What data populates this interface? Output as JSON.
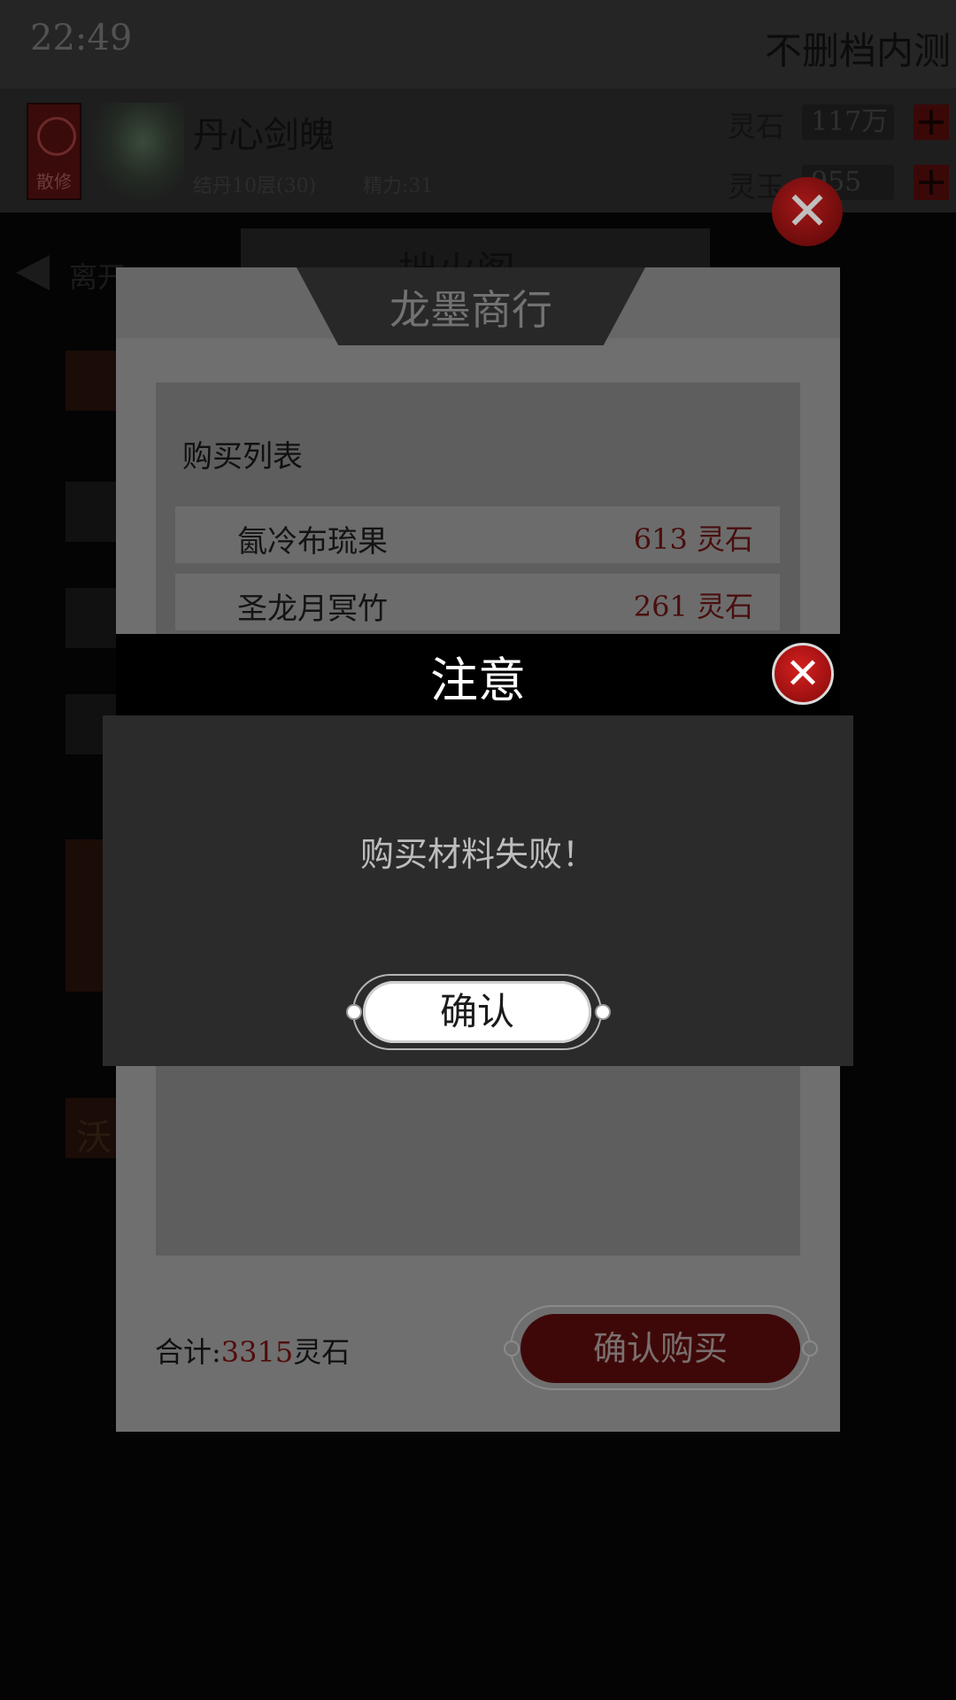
{
  "status_bar": {
    "time": "22:49",
    "test_tag": "不删档内测"
  },
  "player": {
    "sect": "散修",
    "name": "丹心剑魄",
    "level": "结丹10层(30)",
    "power": "精力:31"
  },
  "currencies": [
    {
      "label": "灵石",
      "value": "117万"
    },
    {
      "label": "灵玉",
      "value": "955"
    }
  ],
  "nav": {
    "leave": "离开",
    "pavilion": "拙火阁"
  },
  "side": {
    "chip_text": "沃"
  },
  "shop": {
    "title": "龙墨商行",
    "list_heading": "购买列表",
    "items": [
      {
        "name": "氤冷布琉果",
        "price": "613 灵石"
      },
      {
        "name": "圣龙月冥竹",
        "price": "261 灵石"
      }
    ],
    "total_label": "合计:",
    "total_value": "3315",
    "total_unit": "灵石",
    "buy_button": "确认购买"
  },
  "alert": {
    "title": "注意",
    "message": "购买材料失败！",
    "confirm_button": "确认"
  },
  "icons": {
    "close": "close-icon",
    "plus": "plus-icon",
    "back": "back-arrow-icon"
  },
  "colors": {
    "accent_red": "#9c1010",
    "price_red": "#4a0e0e",
    "alert_body": "#2b2b2b"
  }
}
